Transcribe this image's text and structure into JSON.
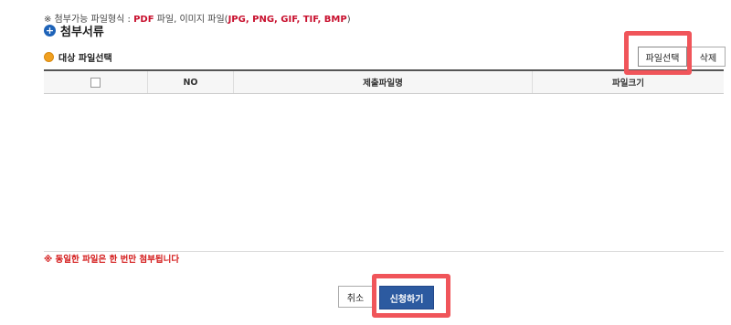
{
  "notice": {
    "prefix": "※ 첨부가능 파일형식 : ",
    "pdf": "PDF",
    "middle": " 파일, 이미지 파일(",
    "formats": "JPG, PNG, GIF, TIF, BMP",
    "suffix": ")"
  },
  "section": {
    "title": "첨부서류",
    "icon": "plus-circle-icon"
  },
  "subsection": {
    "title": "대상 파일선택",
    "icon": "bullet-dot-icon"
  },
  "toolbar": {
    "select_label": "파일선택",
    "delete_label": "삭제"
  },
  "table": {
    "columns": [
      "",
      "NO",
      "제출파일명",
      "파일크기"
    ],
    "rows": []
  },
  "warning": "※ 동일한 파일은 한 번만 첨부됩니다",
  "actions": {
    "cancel_label": "취소",
    "submit_label": "신청하기"
  },
  "colors": {
    "accent": "#2c5aa0",
    "warning": "#d41a1a",
    "highlight": "#f0555a",
    "bullet": "#f0a020"
  }
}
